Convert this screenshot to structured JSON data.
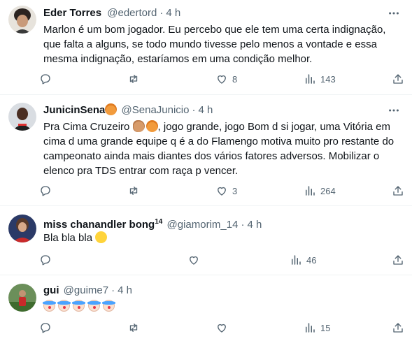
{
  "tweets": [
    {
      "name": "Eder Torres",
      "handle": "@edertord",
      "dot": "·",
      "time": "4 h",
      "text": "Marlon é um bom jogador. Eu percebo que ele tem uma certa indignação, que falta a alguns, se todo mundo tivesse pelo menos a vontade e essa mesma indignação, estaríamos em uma condição melhor.",
      "reply_count": "",
      "retweet_count": "",
      "like_count": "8",
      "view_count": "143",
      "avatar_icon": "avatar-dark-curly-hair"
    },
    {
      "name": "JunicinSena",
      "handle": "@SenaJunicio",
      "dot": "·",
      "time": "4 h",
      "text_part1": "Pra Cima Cruzeiro ",
      "text_part2": ", jogo grande, jogo Bom d si jogar, uma Vitória em cima d uma grande equipe q é a do Flamengo motiva muito pro restante do campeonato ainda mais diantes dos vários fatores adversos. Mobilizar o elenco pra TDS entrar com raça p vencer.",
      "reply_count": "",
      "retweet_count": "",
      "like_count": "3",
      "view_count": "264",
      "name_emoji": "fox-face",
      "text_emojis": [
        "flexed-biceps",
        "fox-face"
      ]
    },
    {
      "name": "miss chanandler bong",
      "name_suffix": "14",
      "handle": "@giamorim_14",
      "dot": "·",
      "time": "4 h",
      "text": "Bla bla bla",
      "text_emoji": "grinning-face",
      "reply_count": "",
      "like_count": "",
      "view_count": "46"
    },
    {
      "name": "gui",
      "handle": "@guime7",
      "dot": "·",
      "time": "4 h",
      "text_emojis": [
        "clown-face",
        "clown-face",
        "clown-face",
        "clown-face",
        "clown-face"
      ],
      "reply_count": "",
      "retweet_count": "",
      "like_count": "",
      "view_count": "15"
    }
  ],
  "colors": {
    "text": "#0f1419",
    "muted": "#536471",
    "divider": "#eff3f4"
  }
}
